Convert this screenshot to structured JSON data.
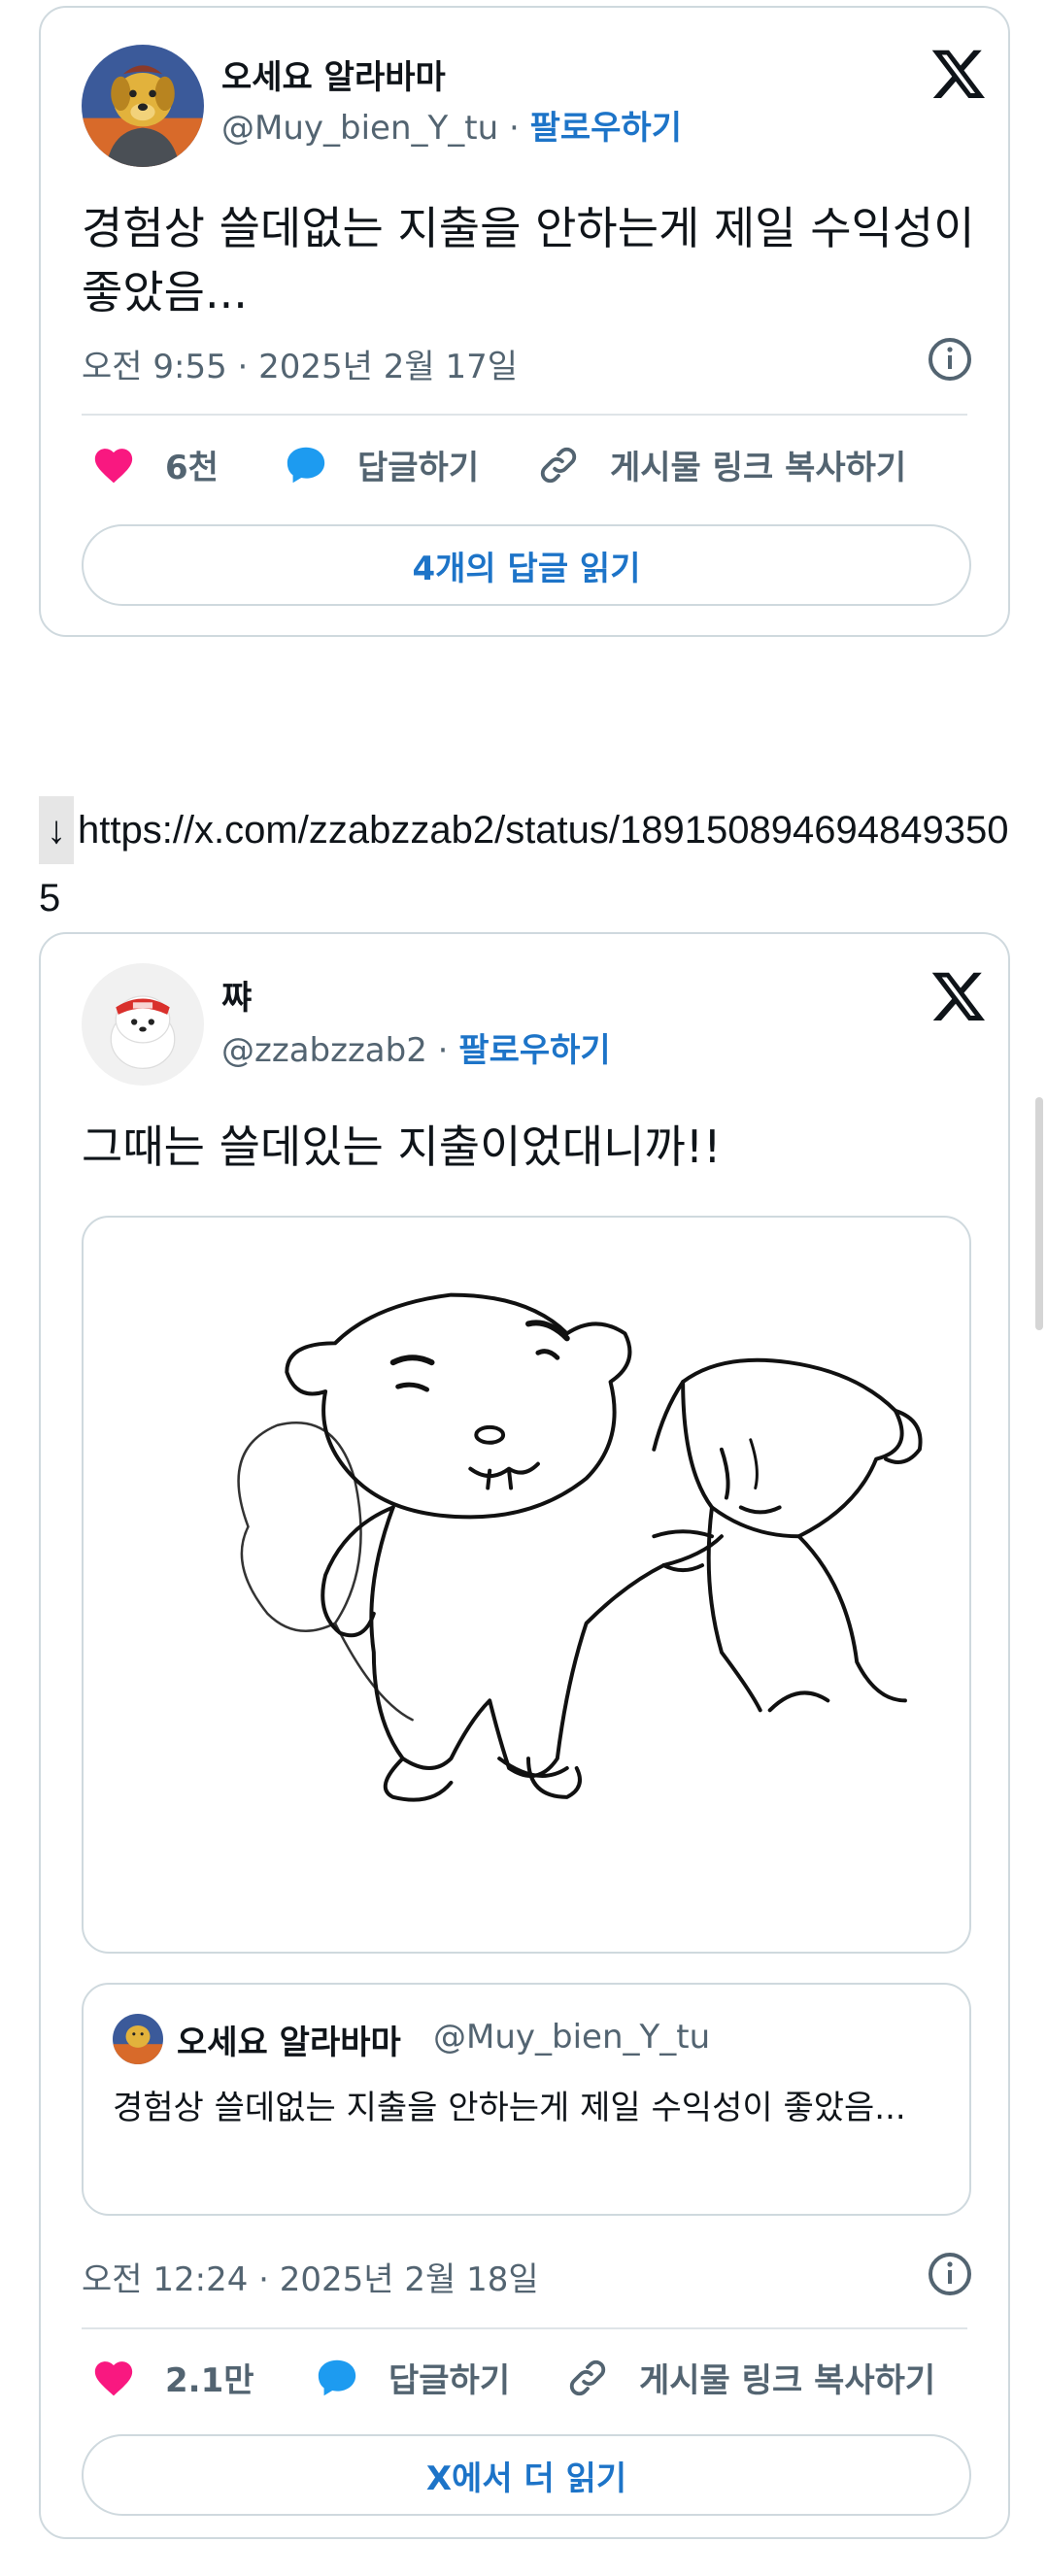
{
  "tweet1": {
    "author_name": "오세요 알라바마",
    "author_handle": "@Muy_bien_Y_tu",
    "separator": "·",
    "follow_label": "팔로우하기",
    "text": "경험상 쓸데없는 지출을 안하는게 제일 수익성이 좋았음...",
    "timestamp": "오전 9:55 · 2025년 2월 17일",
    "likes": "6천",
    "reply_label": "답글하기",
    "copy_link_label": "게시물 링크 복사하기",
    "read_replies_label": "4개의 답글 읽기"
  },
  "link": {
    "arrow": "↓",
    "url": "https://x.com/zzabzzab2/status/1891508946948493505"
  },
  "tweet2": {
    "author_name": "쨔",
    "author_handle": "@zzabzzab2",
    "separator": "·",
    "follow_label": "팔로우하기",
    "text": "그때는 쓸데있는 지출이었대니까!!",
    "timestamp": "오전 12:24 · 2025년 2월 18일",
    "likes": "2.1만",
    "reply_label": "답글하기",
    "copy_link_label": "게시물 링크 복사하기",
    "read_more_label": "X에서 더 읽기",
    "quote": {
      "author_name": "오세요 알라바마",
      "author_handle": "@Muy_bien_Y_tu",
      "text": "경험상 쓸데없는 지출을 안하는게 제일 수익성이 좋았음..."
    }
  },
  "colors": {
    "heart": "#f91880",
    "reply_bubble": "#1d9bf0",
    "link_blue": "#1d74c8",
    "border": "#cfd9de"
  },
  "icons": [
    "x-logo-icon",
    "info-icon",
    "heart-icon",
    "reply-bubble-icon",
    "link-icon"
  ]
}
